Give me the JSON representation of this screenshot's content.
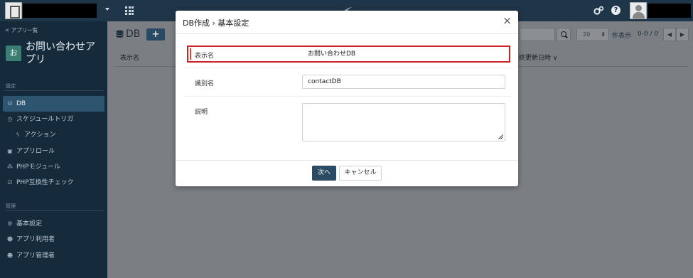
{
  "topbar": {
    "help_glyph": "?"
  },
  "sidebar": {
    "back_link": "< アプリ一覧",
    "app_badge": "お",
    "app_title": "お問い合わせアプリ",
    "sections": [
      {
        "label": "設定"
      },
      {
        "label": "管理"
      }
    ],
    "items": [
      {
        "label": "DB",
        "icon": "database-icon",
        "active": true
      },
      {
        "label": "スケジュールトリガ",
        "icon": "clock-icon"
      },
      {
        "label": "アクション",
        "icon": "bolt-icon"
      },
      {
        "label": "アプリロール",
        "icon": "id-card-icon"
      },
      {
        "label": "PHPモジュール",
        "icon": "cubes-icon"
      },
      {
        "label": "PHP互換性チェック",
        "icon": "check-square-icon"
      },
      {
        "label": "基本設定",
        "icon": "gear-icon"
      },
      {
        "label": "アプリ利用者",
        "icon": "users-icon"
      },
      {
        "label": "アプリ管理者",
        "icon": "users-icon"
      }
    ]
  },
  "main": {
    "title": "DB",
    "add_label": "+",
    "columns": {
      "name": "表示名",
      "updated": "最終更新日時 ∨"
    },
    "per_page_value": "20",
    "per_page_label": "件表示",
    "page_count": "0-0 / 0",
    "pager_prev": "◀",
    "pager_next": "▶"
  },
  "modal": {
    "title": "DB作成 › 基本設定",
    "close_glyph": "×",
    "fields": [
      {
        "label": "表示名",
        "value": "お問い合わせDB"
      },
      {
        "label": "識別名",
        "value": "contactDB"
      },
      {
        "label": "説明",
        "value": ""
      }
    ],
    "next_label": "次へ",
    "cancel_label": "キャンセル"
  },
  "colors": {
    "topbar": "#1f3548",
    "sidebar": "#152a3a",
    "active_nav": "#2d5570",
    "primary_button": "#2b4a63",
    "highlight": "#cc2222"
  }
}
